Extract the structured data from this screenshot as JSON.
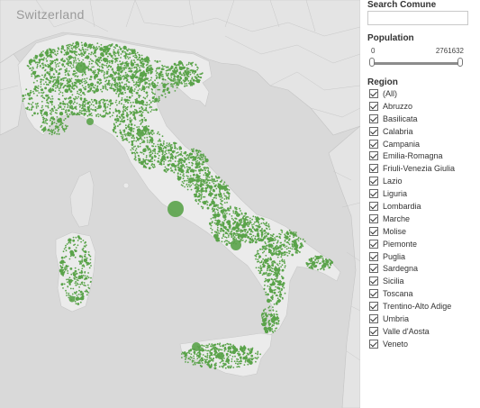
{
  "map": {
    "country_label": "Switzerland",
    "dot_color": "#5aa34a",
    "land_color": "#ebebeb",
    "sea_color": "#d9d9d9"
  },
  "search": {
    "title": "Search Comune",
    "placeholder": ""
  },
  "population": {
    "title": "Population",
    "min": "0",
    "max": "2761632",
    "selected_min": 0,
    "selected_max": 2761632
  },
  "region_filter": {
    "title": "Region",
    "items": [
      {
        "label": "(All)",
        "checked": true
      },
      {
        "label": "Abruzzo",
        "checked": true
      },
      {
        "label": "Basilicata",
        "checked": true
      },
      {
        "label": "Calabria",
        "checked": true
      },
      {
        "label": "Campania",
        "checked": true
      },
      {
        "label": "Emilia-Romagna",
        "checked": true
      },
      {
        "label": "Friuli-Venezia Giulia",
        "checked": true
      },
      {
        "label": "Lazio",
        "checked": true
      },
      {
        "label": "Liguria",
        "checked": true
      },
      {
        "label": "Lombardia",
        "checked": true
      },
      {
        "label": "Marche",
        "checked": true
      },
      {
        "label": "Molise",
        "checked": true
      },
      {
        "label": "Piemonte",
        "checked": true
      },
      {
        "label": "Puglia",
        "checked": true
      },
      {
        "label": "Sardegna",
        "checked": true
      },
      {
        "label": "Sicilia",
        "checked": true
      },
      {
        "label": "Toscana",
        "checked": true
      },
      {
        "label": "Trentino-Alto Adige",
        "checked": true
      },
      {
        "label": "Umbria",
        "checked": true
      },
      {
        "label": "Valle d'Aosta",
        "checked": true
      },
      {
        "label": "Veneto",
        "checked": true
      }
    ]
  }
}
